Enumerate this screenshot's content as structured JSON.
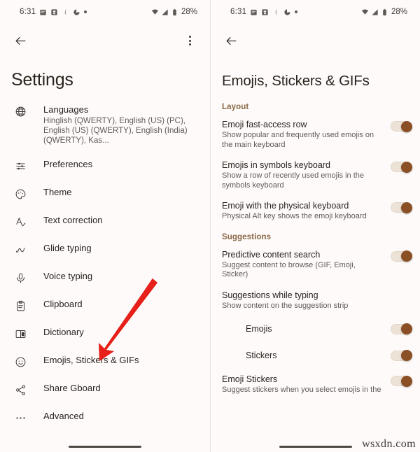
{
  "status_bar": {
    "time": "6:31",
    "battery_percent": "28%",
    "icons": [
      "calendar-icon",
      "save-icon",
      "moon-icon",
      "data-saver-icon",
      "dot-icon",
      "wifi-icon",
      "signal-icon",
      "battery-icon"
    ]
  },
  "left_screen": {
    "title": "Settings",
    "back_label": "Back",
    "overflow_label": "More options",
    "items": [
      {
        "icon": "globe-icon",
        "label": "Languages",
        "sublabel": "Hinglish (QWERTY), English (US) (PC), English (US) (QWERTY), English (India) (QWERTY), Kas..."
      },
      {
        "icon": "sliders-icon",
        "label": "Preferences",
        "sublabel": ""
      },
      {
        "icon": "palette-icon",
        "label": "Theme",
        "sublabel": ""
      },
      {
        "icon": "spellcheck-icon",
        "label": "Text correction",
        "sublabel": ""
      },
      {
        "icon": "glide-icon",
        "label": "Glide typing",
        "sublabel": ""
      },
      {
        "icon": "microphone-icon",
        "label": "Voice typing",
        "sublabel": ""
      },
      {
        "icon": "clipboard-icon",
        "label": "Clipboard",
        "sublabel": ""
      },
      {
        "icon": "dictionary-icon",
        "label": "Dictionary",
        "sublabel": ""
      },
      {
        "icon": "emoji-icon",
        "label": "Emojis, Stickers & GIFs",
        "sublabel": ""
      },
      {
        "icon": "share-icon",
        "label": "Share Gboard",
        "sublabel": ""
      },
      {
        "icon": "more-icon",
        "label": "Advanced",
        "sublabel": ""
      }
    ],
    "annotation": {
      "type": "red-arrow",
      "points_to": "Emojis, Stickers & GIFs",
      "color": "#e01b11"
    }
  },
  "right_screen": {
    "title": "Emojis, Stickers & GIFs",
    "back_label": "Back",
    "sections": [
      {
        "header": "Layout",
        "items": [
          {
            "label": "Emoji fast-access row",
            "sublabel": "Show popular and frequently used emojis on the main keyboard",
            "toggle": "on",
            "indent": false
          },
          {
            "label": "Emojis in symbols keyboard",
            "sublabel": "Show a row of recently used emojis in the symbols keyboard",
            "toggle": "on",
            "indent": false
          },
          {
            "label": "Emoji with the physical keyboard",
            "sublabel": "Physical Alt key shows the emoji keyboard",
            "toggle": "on",
            "indent": false
          }
        ]
      },
      {
        "header": "Suggestions",
        "items": [
          {
            "label": "Predictive content search",
            "sublabel": "Suggest content to browse (GIF, Emoji, Sticker)",
            "toggle": "on",
            "indent": false
          },
          {
            "label": "Suggestions while typing",
            "sublabel": "Show content on the suggestion strip",
            "toggle": "none",
            "indent": false
          },
          {
            "label": "Emojis",
            "sublabel": "",
            "toggle": "on",
            "indent": true
          },
          {
            "label": "Stickers",
            "sublabel": "",
            "toggle": "on",
            "indent": true
          },
          {
            "label": "Emoji Stickers",
            "sublabel": "Suggest stickers when you select emojis in the",
            "toggle": "on",
            "indent": false
          }
        ]
      }
    ]
  },
  "watermark": "wsxdn.com",
  "colors": {
    "background": "#fdfaf9",
    "section_header": "#8a6845",
    "toggle_thumb": "#8a4f24",
    "toggle_track": "#ece2d6",
    "arrow": "#e01b11",
    "primary_text": "#27241f",
    "secondary_text": "#5f5b57"
  }
}
